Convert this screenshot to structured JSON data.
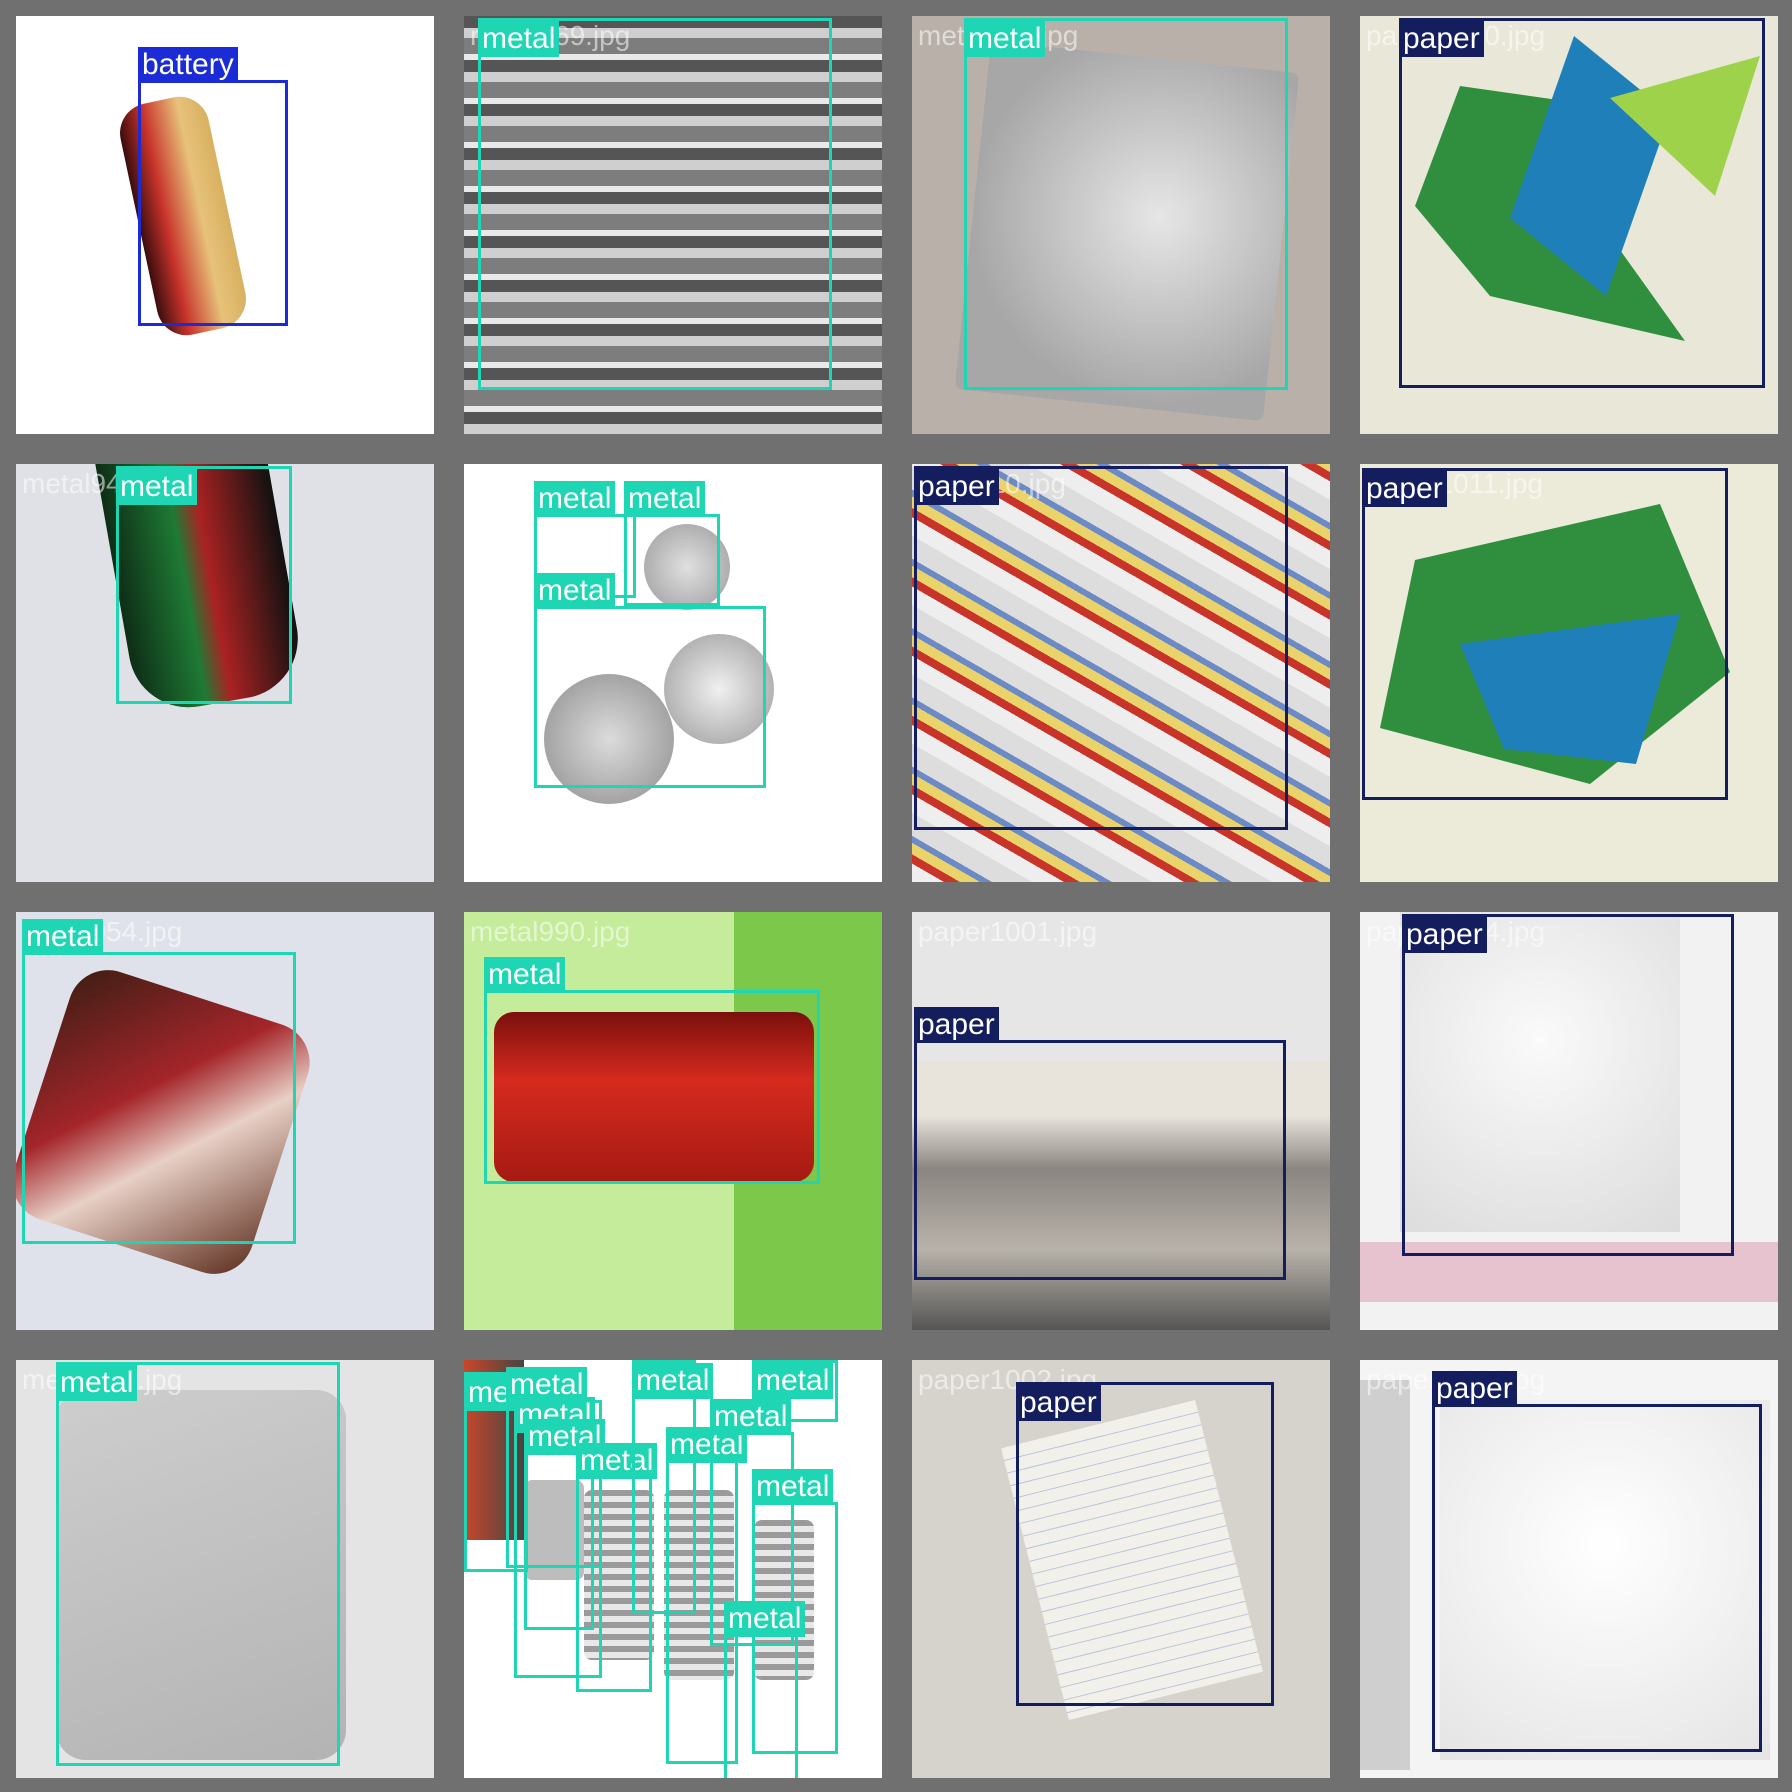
{
  "colors": {
    "battery": "#1b2bd6",
    "metal": "#1fd6b4",
    "paper": "#141e5e",
    "grid": "#707070"
  },
  "tiles": [
    {
      "file": "battery1000.jpg",
      "bg": "#ffffff",
      "boxes": [
        {
          "label": "battery",
          "cls": "battery"
        }
      ]
    },
    {
      "file": "metal969.jpg",
      "bg": "#8c8c8c",
      "boxes": [
        {
          "label": "metal",
          "cls": "metal"
        }
      ]
    },
    {
      "file": "metal996.jpg",
      "bg": "#b9b1a9",
      "boxes": [
        {
          "label": "metal",
          "cls": "metal"
        }
      ]
    },
    {
      "file": "paper1010.jpg",
      "bg": "#e9e7d8",
      "boxes": [
        {
          "label": "paper",
          "cls": "paper"
        }
      ]
    },
    {
      "file": "metal944.jpg",
      "bg": "#dfe1e6",
      "boxes": [
        {
          "label": "metal",
          "cls": "metal"
        }
      ]
    },
    {
      "file": "metal99.jpg",
      "bg": "#ffffff",
      "boxes": [
        {
          "label": "metal",
          "cls": "metal"
        },
        {
          "label": "metal",
          "cls": "metal"
        },
        {
          "label": "metal",
          "cls": "metal"
        }
      ]
    },
    {
      "file": "paper10.jpg",
      "bg": "#c9c1b3",
      "boxes": [
        {
          "label": "paper",
          "cls": "paper"
        }
      ]
    },
    {
      "file": "paper1011.jpg",
      "bg": "#ecead9",
      "boxes": [
        {
          "label": "paper",
          "cls": "paper"
        }
      ]
    },
    {
      "file": "metal954.jpg",
      "bg": "#dfe2ea",
      "boxes": [
        {
          "label": "metal",
          "cls": "metal"
        }
      ]
    },
    {
      "file": "metal990.jpg",
      "bg": "#c4ec9a",
      "boxes": [
        {
          "label": "metal",
          "cls": "metal"
        }
      ]
    },
    {
      "file": "paper1001.jpg",
      "bg": "#e6e6e6",
      "boxes": [
        {
          "label": "paper",
          "cls": "paper"
        }
      ]
    },
    {
      "file": "paper1014.jpg",
      "bg": "#f2f2f2",
      "boxes": [
        {
          "label": "paper",
          "cls": "paper"
        }
      ]
    },
    {
      "file": "metal957.jpg",
      "bg": "#e4e4e4",
      "boxes": [
        {
          "label": "metal",
          "cls": "metal"
        }
      ]
    },
    {
      "file": "metal994.jpg",
      "bg": "#ffffff",
      "boxes": [
        {
          "label": "metal",
          "cls": "metal"
        },
        {
          "label": "metal",
          "cls": "metal"
        },
        {
          "label": "metal",
          "cls": "metal"
        },
        {
          "label": "metal",
          "cls": "metal"
        },
        {
          "label": "metal",
          "cls": "metal"
        },
        {
          "label": "metal",
          "cls": "metal"
        },
        {
          "label": "metal",
          "cls": "metal"
        },
        {
          "label": "metal",
          "cls": "metal"
        },
        {
          "label": "metal",
          "cls": "metal"
        },
        {
          "label": "metal",
          "cls": "metal"
        },
        {
          "label": "metal",
          "cls": "metal"
        }
      ]
    },
    {
      "file": "paper1002.jpg",
      "bg": "#d6d2cc",
      "boxes": [
        {
          "label": "paper",
          "cls": "paper"
        }
      ]
    },
    {
      "file": "paper1015.jpg",
      "bg": "#f4f4f4",
      "boxes": [
        {
          "label": "paper",
          "cls": "paper"
        }
      ]
    }
  ]
}
